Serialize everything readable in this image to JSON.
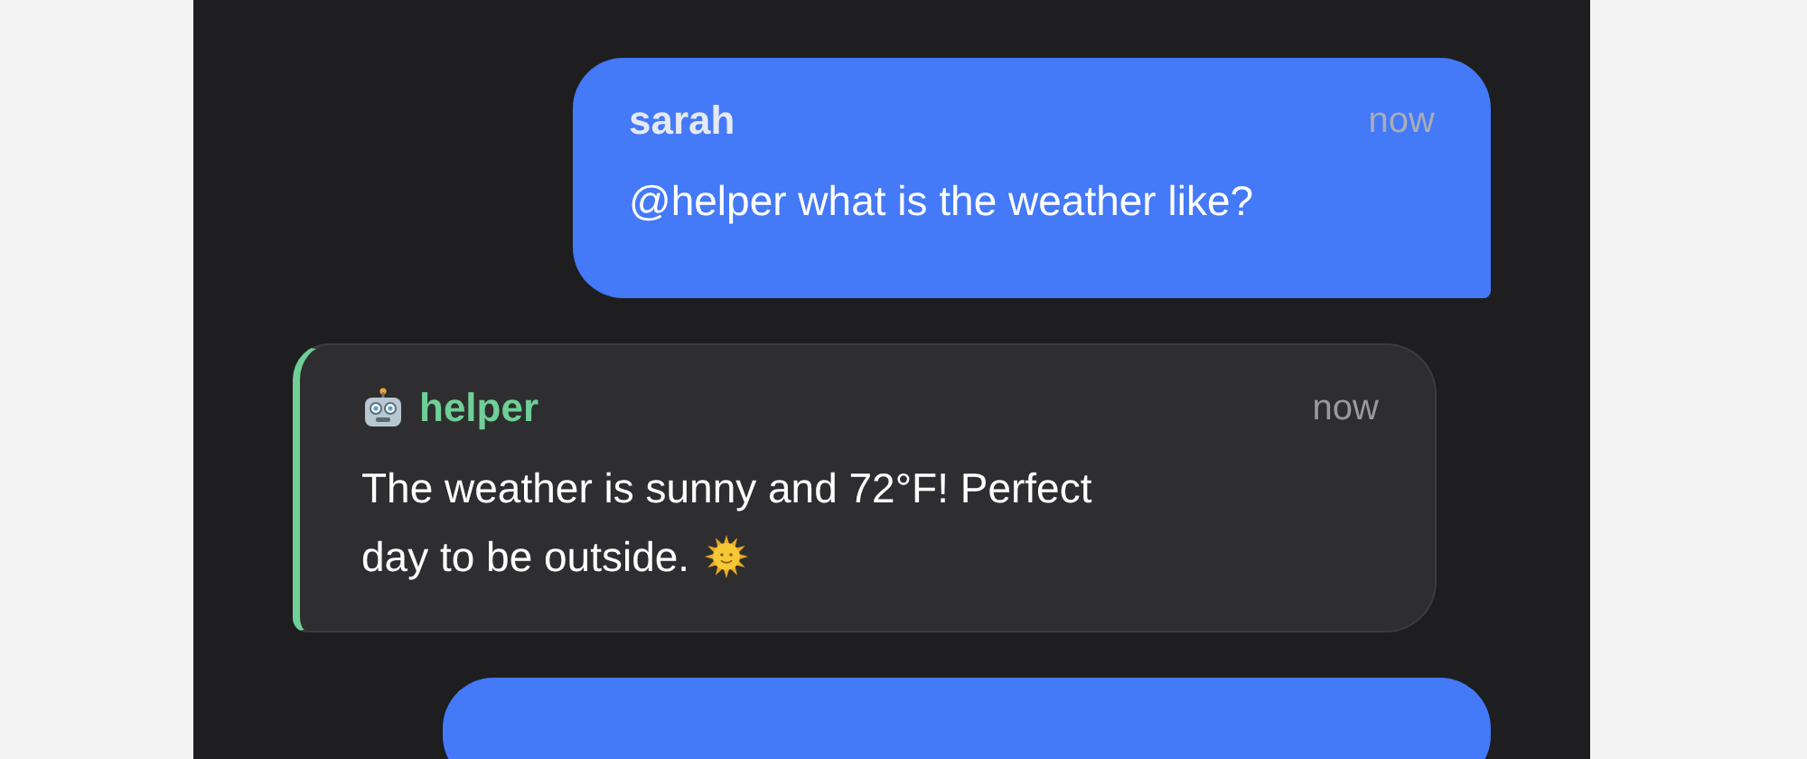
{
  "messages": [
    {
      "kind": "user",
      "sender": "sarah",
      "time": "now",
      "text": "@helper what is the weather like?"
    },
    {
      "kind": "bot",
      "sender": "helper",
      "time": "now",
      "text": "The weather is sunny and 72°F! Perfect day to be outside.",
      "sun_icon": true
    },
    {
      "kind": "user"
    }
  ]
}
